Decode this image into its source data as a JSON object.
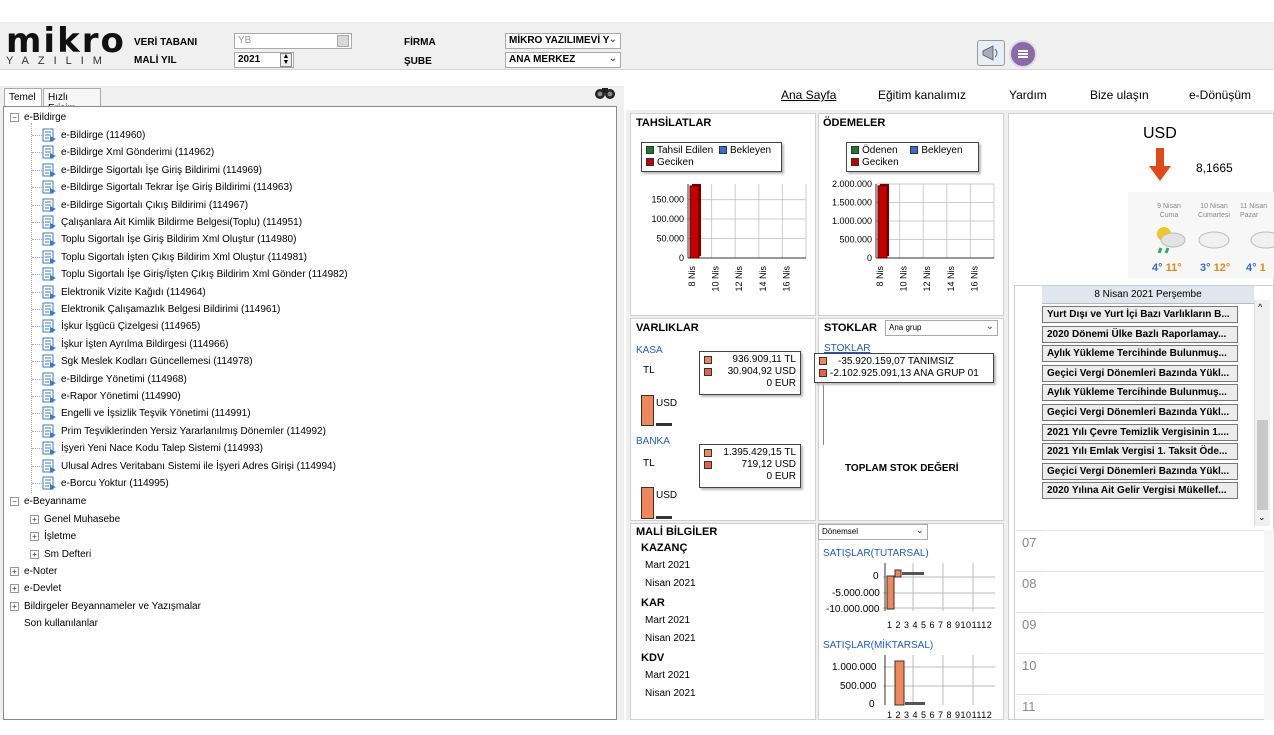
{
  "header": {
    "logo_main": "mikro",
    "logo_sub": "YAZILIM",
    "db_label": "VERİ TABANI",
    "db_value": "YB",
    "year_label": "MALİ YIL",
    "year_value": "2021",
    "firm_label": "FİRMA",
    "firm_value": "MİKRO YAZILIMEVİ Y",
    "branch_label": "ŞUBE",
    "branch_value": "ANA MERKEZ"
  },
  "tabs": [
    "Temel",
    "Hızlı Erişim"
  ],
  "tree": {
    "root1": "e-Bildirge",
    "items": [
      "e-Bildirge (114960)",
      "e-Bildirge Xml Gönderimi (114962)",
      "e-Bildirge Sigortalı İşe Giriş Bildirimi (114969)",
      "e-Bildirge Sigortalı Tekrar İşe Giriş Bildirimi (114963)",
      "e-Bildirge Sigortalı Çıkış Bildirimi (114967)",
      "Çalışanlara Ait Kimlik Bildirme Belgesi(Toplu) (114951)",
      "Toplu Sigortalı İşe Giriş Bildirim Xml Oluştur (114980)",
      "Toplu Sigortalı İşten Çıkış Bildirim Xml Oluştur (114981)",
      "Toplu Sigortalı İşe Giriş/İşten Çıkış Bildirim Xml Gönder (114982)",
      "Elektronik Vizite Kağıdı (114964)",
      "Elektronik Çalışamazlık Belgesi Bildirimi (114961)",
      "İşkur İşgücü Çizelgesi (114965)",
      "İşkur İşten Ayrılma Bildirgesi (114966)",
      "Sgk Meslek Kodları Güncellemesi (114978)",
      "e-Bildirge Yönetimi (114968)",
      "e-Rapor Yönetimi (114990)",
      "Engelli ve İşsizlik Teşvik Yönetimi (114991)",
      "Prim Teşviklerinden Yersiz Yararlanılmış Dönemler (114992)",
      "İşyeri Yeni Nace Kodu Talep Sistemi (114993)",
      "Ulusal Adres Veritabanı Sistemi ile İşyeri Adres Girişi (114994)",
      "e-Borcu Yoktur (114995)"
    ],
    "root2": "e-Beyanname",
    "sub2": [
      "Genel Muhasebe",
      "İşletme",
      "Sm Defteri"
    ],
    "roots_rest": [
      "e-Noter",
      "e-Devlet",
      "Bildirgeler Beyannameler ve Yazışmalar"
    ],
    "last": "Son kullanılanlar"
  },
  "nav": [
    "Ana Sayfa",
    "Eğitim kanalımız",
    "Yardım",
    "Bize ulaşın",
    "e-Dönüşüm"
  ],
  "tahsilat": {
    "title": "TAHSİLATLAR",
    "legend": [
      "Tahsil Edilen",
      "Bekleyen",
      "Geciken"
    ],
    "yticks": [
      "150.000",
      "100.000",
      "50.000",
      "0"
    ],
    "xticks": [
      "8 Nis",
      "10 Nis",
      "12 Nis",
      "14 Nis",
      "16 Nis"
    ]
  },
  "odeme": {
    "title": "ÖDEMELER",
    "legend": [
      "Ödenen",
      "Bekleyen",
      "Geciken"
    ],
    "yticks": [
      "2.000.000",
      "1.500.000",
      "1.000.000",
      "500.000",
      "0"
    ],
    "xticks": [
      "8 Nis",
      "10 Nis",
      "12 Nis",
      "14 Nis",
      "16 Nis"
    ]
  },
  "varlik": {
    "title": "VARLIKLAR",
    "kasa": "KASA",
    "tl": "TL",
    "usd": "USD",
    "kasa_vals": [
      "936.909,11 TL",
      "30.904,92 USD",
      "0 EUR"
    ],
    "banka": "BANKA",
    "banka_vals": [
      "1.395.429,15 TL",
      "719,12 USD",
      "0 EUR"
    ]
  },
  "stok": {
    "title": "STOKLAR",
    "select": "Ana grup",
    "sub": "STOKLAR",
    "vals": [
      "-35.920.159,07 TANIMSIZ",
      "-2.102.925.091,13 ANA GRUP 01"
    ],
    "total": "TOPLAM STOK DEĞERİ"
  },
  "mali": {
    "title": "MALİ BİLGİLER",
    "select": "Dönemsel",
    "groups": [
      {
        "name": "KAZANÇ",
        "rows": [
          "Mart 2021",
          "Nisan 2021"
        ]
      },
      {
        "name": "KAR",
        "rows": [
          "Mart 2021",
          "Nisan 2021"
        ]
      },
      {
        "name": "KDV",
        "rows": [
          "Mart 2021",
          "Nisan 2021"
        ]
      }
    ],
    "sat_tutar": "SATIŞLAR(TUTARSAL)",
    "sat_tutar_y": [
      "0",
      "-5.000.000",
      "-10.000.000"
    ],
    "sat_miktar": "SATIŞLAR(MİKTARSAL)",
    "sat_miktar_y": [
      "1.000.000",
      "500.000",
      "0"
    ],
    "months_x": "1 2 3 4 5 6 7 8 9101112"
  },
  "currency": {
    "code": "USD",
    "value": "8,1665"
  },
  "weather": [
    {
      "day": "9 Nisan",
      "dow": "Cuma",
      "lo": "4°",
      "hi": "11°"
    },
    {
      "day": "10 Nisan",
      "dow": "Cumartesi",
      "lo": "3°",
      "hi": "12°"
    },
    {
      "day": "11 Nisan",
      "dow": "Pazar",
      "lo": "4°",
      "hi": "1"
    }
  ],
  "agenda": {
    "date": "8 Nisan 2021 Perşembe",
    "items": [
      "Yurt Dışı ve Yurt İçi Bazı Varlıkların B...",
      "2020 Dönemi Ülke Bazlı Raporlamay...",
      "Aylık Yükleme Tercihinde Bulunmuş...",
      "Geçici Vergi Dönemleri Bazında Yükl...",
      "Aylık Yükleme Tercihinde Bulunmuş...",
      "Geçici Vergi Dönemleri Bazında Yükl...",
      "2021 Yılı Çevre Temizlik Vergisinin 1....",
      "2021 Yılı Emlak Vergisi 1. Taksit Öde...",
      "Geçici Vergi Dönemleri Bazında Yükl...",
      "2020 Yılına Ait Gelir Vergisi Mükellef..."
    ],
    "hours": [
      "07",
      "08",
      "09",
      "10",
      "11"
    ]
  },
  "chart_data": [
    {
      "type": "bar",
      "title": "TAHSİLATLAR",
      "categories": [
        "8 Nis",
        "10 Nis",
        "12 Nis",
        "14 Nis",
        "16 Nis"
      ],
      "series": [
        {
          "name": "Geciken",
          "values": [
            185000,
            0,
            0,
            0,
            0
          ]
        }
      ],
      "ylim": [
        0,
        190000
      ]
    },
    {
      "type": "bar",
      "title": "ÖDEMELER",
      "categories": [
        "8 Nis",
        "10 Nis",
        "12 Nis",
        "14 Nis",
        "16 Nis"
      ],
      "series": [
        {
          "name": "Geciken",
          "values": [
            1950000,
            0,
            0,
            0,
            0
          ]
        }
      ],
      "ylim": [
        0,
        2000000
      ]
    }
  ],
  "colors": {
    "green": "#1a7a2e",
    "blue": "#2f6fd6",
    "red": "#c40000",
    "orange": "#f0875a",
    "accent": "#e04a1a"
  }
}
